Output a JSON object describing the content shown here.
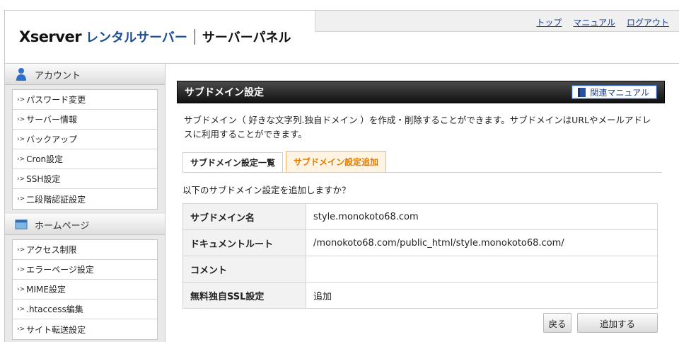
{
  "header": {
    "logo_brand": "Xserver",
    "logo_rental": "レンタルサーバー",
    "logo_panel": "サーバーパネル",
    "links": [
      "トップ",
      "マニュアル",
      "ログアウト"
    ]
  },
  "sidebar": {
    "sections": [
      {
        "title": "アカウント",
        "icon": "user-icon",
        "items": [
          "パスワード変更",
          "サーバー情報",
          "バックアップ",
          "Cron設定",
          "SSH設定",
          "二段階認証設定"
        ]
      },
      {
        "title": "ホームページ",
        "icon": "window-icon",
        "items": [
          "アクセス制限",
          "エラーページ設定",
          "MIME設定",
          ".htaccess編集",
          "サイト転送設定"
        ]
      }
    ]
  },
  "main": {
    "title": "サブドメイン設定",
    "manual_button": "関連マニュアル",
    "description": "サブドメイン（ 好きな文字列.独自ドメイン ）を作成・削除することができます。サブドメインはURLやメールアドレスに利用することができます。",
    "tabs": [
      {
        "label": "サブドメイン設定一覧",
        "active": false
      },
      {
        "label": "サブドメイン設定追加",
        "active": true
      }
    ],
    "confirm_text": "以下のサブドメイン設定を追加しますか？",
    "rows": [
      {
        "label": "サブドメイン名",
        "value": "style.monokoto68.com"
      },
      {
        "label": "ドキュメントルート",
        "value": "/monokoto68.com/public_html/style.monokoto68.com/"
      },
      {
        "label": "コメント",
        "value": ""
      },
      {
        "label": "無料独自SSL設定",
        "value": "追加"
      }
    ],
    "back_button": "戻る",
    "submit_button": "追加する"
  },
  "colors": {
    "brand_blue": "#1c4d93",
    "link_blue": "#1b3f8f",
    "tab_active": "#e07b00"
  }
}
